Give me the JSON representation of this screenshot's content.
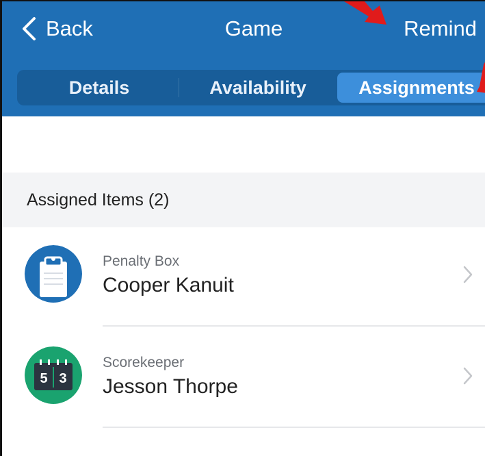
{
  "navbar": {
    "back_label": "Back",
    "title": "Game",
    "remind_label": "Remind",
    "bg_color": "#1f6fb5"
  },
  "tabs": [
    {
      "label": "Details",
      "active": false
    },
    {
      "label": "Availability",
      "active": false
    },
    {
      "label": "Assignments",
      "active": true
    }
  ],
  "section": {
    "title": "Assigned Items (2)"
  },
  "items": [
    {
      "role": "Penalty Box",
      "name": "Cooper Kanuit",
      "icon": "clipboard-icon",
      "icon_color": "#1f6fb5"
    },
    {
      "role": "Scorekeeper",
      "name": "Jesson Thorpe",
      "icon": "scoreboard-icon",
      "icon_color": "#1aa36f",
      "score_digits": [
        "5",
        "3"
      ]
    }
  ],
  "annotation_color": "#e01b1b"
}
